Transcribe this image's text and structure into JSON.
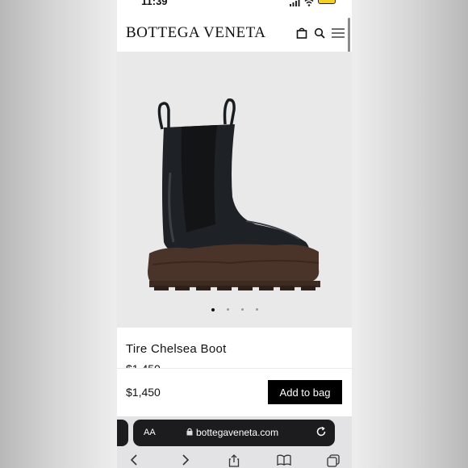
{
  "status_bar": {
    "time": "11:39"
  },
  "header": {
    "brand": "BOTTEGA VENETA"
  },
  "carousel": {
    "slides": 4,
    "active_index": 0
  },
  "product": {
    "name": "Tire Chelsea Boot",
    "price": "$1,450"
  },
  "bag_bar": {
    "price": "$1,450",
    "add_label": "Add to bag"
  },
  "browser": {
    "aa_label": "AA",
    "url": "bottegaveneta.com"
  },
  "icons": {
    "signal": "signal-icon",
    "wifi": "wifi-icon",
    "battery": "battery-icon",
    "bag": "shopping-bag-icon",
    "search": "search-icon",
    "menu": "hamburger-menu-icon",
    "lock": "lock-icon",
    "reload": "reload-icon",
    "back": "back-icon",
    "forward": "forward-icon",
    "share": "share-icon",
    "bookmarks": "bookmarks-icon",
    "tabs": "tabs-icon"
  },
  "colors": {
    "button_bg": "#000000",
    "boot_leather": "#1e2226",
    "boot_sole": "#4a3328",
    "hero_bg": "#e9e9ea",
    "url_bar_bg": "#1c1c1e"
  }
}
